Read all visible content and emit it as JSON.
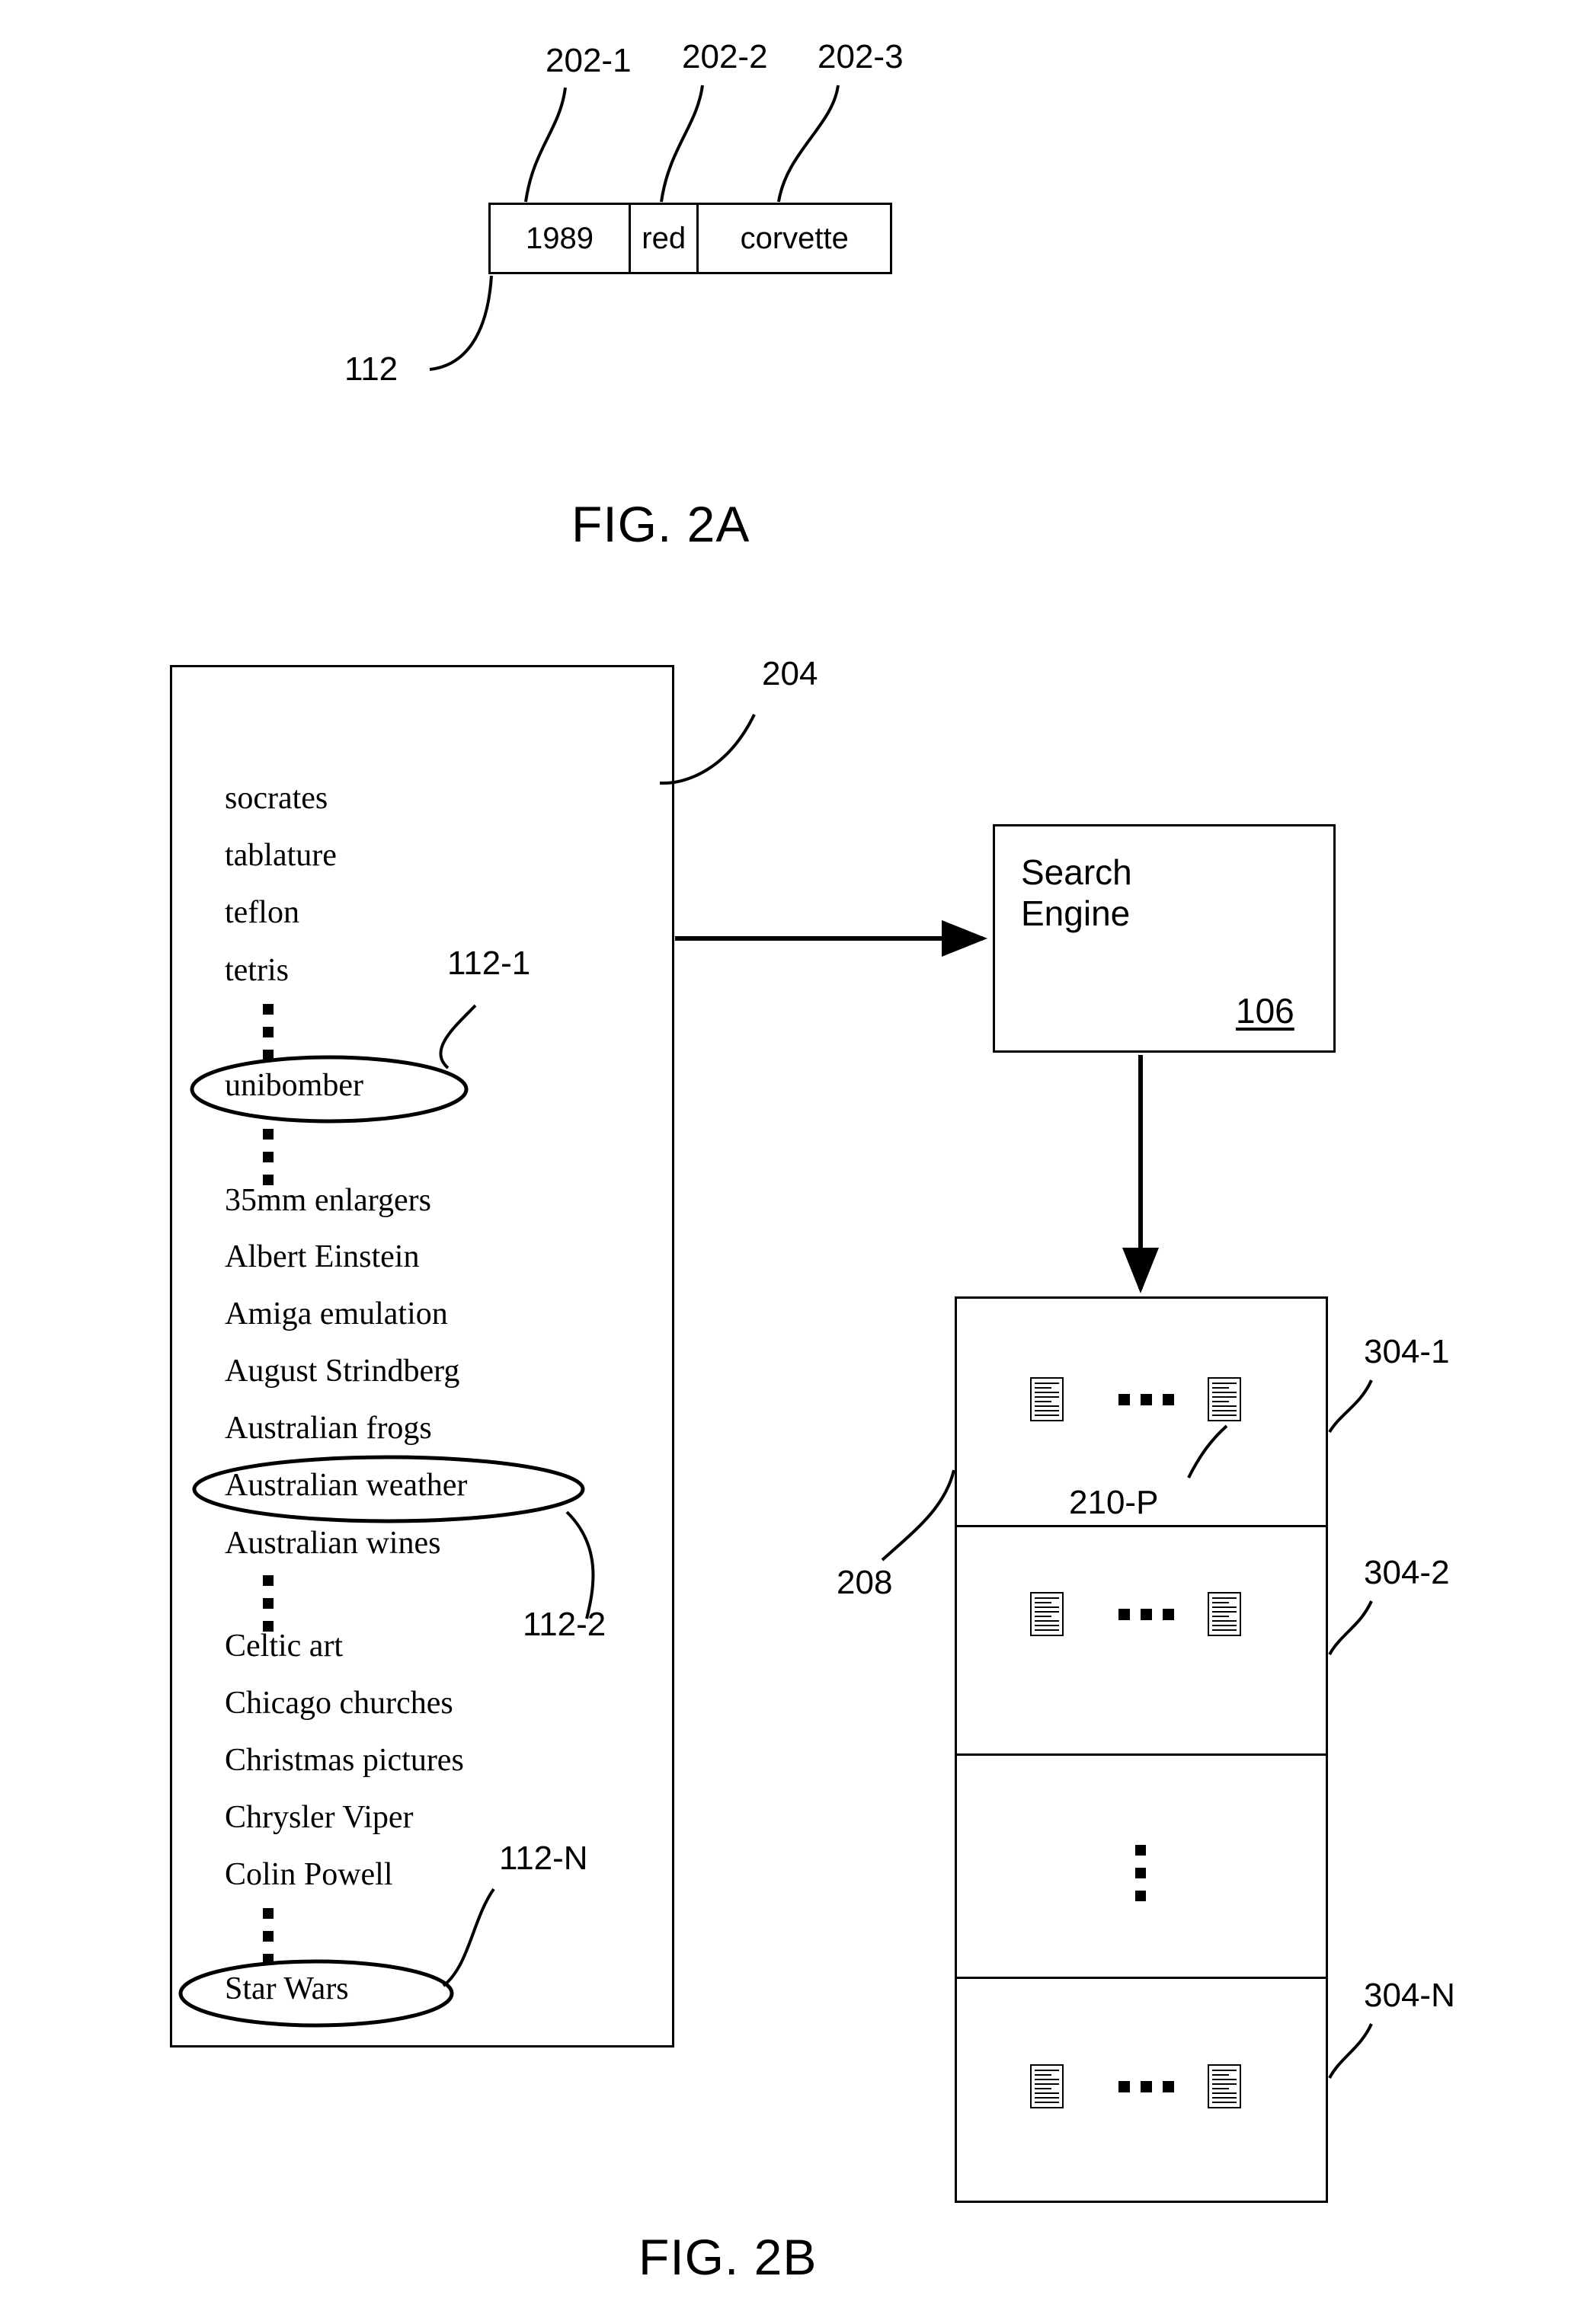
{
  "figures": {
    "fig2a": {
      "caption": "FIG. 2A",
      "record_ref": "112",
      "field_refs": [
        "202-1",
        "202-2",
        "202-3"
      ],
      "fields": [
        "1989",
        "red",
        "corvette"
      ]
    },
    "fig2b": {
      "caption": "FIG. 2B",
      "list_ref": "204",
      "results_ref": "208",
      "keyword_refs": {
        "first": "112-1",
        "second": "112-2",
        "last": "112-N"
      },
      "keywords": [
        "socrates",
        "tablature",
        "teflon",
        "tetris",
        "unibomber",
        "35mm enlargers",
        "Albert Einstein",
        "Amiga emulation",
        "August Strindberg",
        "Australian frogs",
        "Australian weather",
        "Australian wines",
        "Celtic art",
        "Chicago churches",
        "Christmas pictures",
        "Chrysler Viper",
        "Colin Powell",
        "Star Wars"
      ],
      "circled_keywords": [
        "unibomber",
        "Australian weather",
        "Star Wars"
      ],
      "search_engine": {
        "title": "Search\nEngine",
        "ref": "106"
      },
      "results": {
        "document_ref": "210-P",
        "panel_refs": [
          "304-1",
          "304-2",
          "304-N"
        ]
      }
    }
  }
}
